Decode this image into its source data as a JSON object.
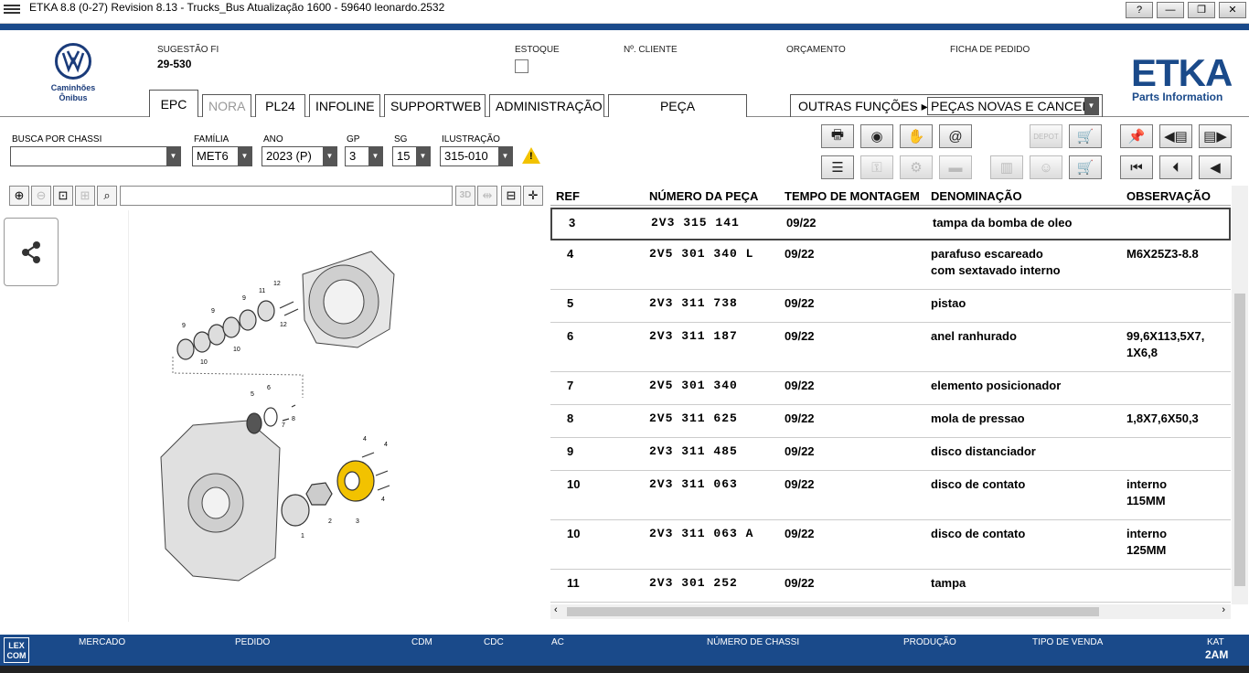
{
  "window": {
    "title": "ETKA 8.8 (0-27) Revision 8.13 - Trucks_Bus Atualização 1600 - 59640 leonardo.2532",
    "buttons": [
      "?",
      "—",
      "❐",
      "✕"
    ]
  },
  "brand": {
    "vw_line1": "Caminhões",
    "vw_line2": "Ônibus",
    "etka": "ETKA",
    "etka_sub": "Parts Information"
  },
  "header": {
    "sugestao_label": "SUGESTÃO FI",
    "sugestao_value": "29-530",
    "estoque_label": "ESTOQUE",
    "cliente_label": "Nº. CLIENTE",
    "orcamento_label": "ORÇAMENTO",
    "ficha_label": "FICHA DE PEDIDO"
  },
  "tabs": [
    {
      "label": "EPC"
    },
    {
      "label": "NORA"
    },
    {
      "label": "PL24"
    },
    {
      "label": "INFOLINE"
    },
    {
      "label": "SUPPORTWEB"
    },
    {
      "label": "ADMINISTRAÇÃO"
    },
    {
      "label": "PEÇA NORMALIZADA"
    }
  ],
  "outras": {
    "label": "OUTRAS FUNÇÕES",
    "value": "PEÇAS NOVAS E CANCEL."
  },
  "filters": {
    "chassi_label": "BUSCA POR CHASSI",
    "chassi_value": "",
    "familia_label": "FAMÍLIA",
    "familia_value": "MET6",
    "ano_label": "ANO",
    "ano_value": "2023 (P)",
    "gp_label": "GP",
    "gp_value": "3",
    "sg_label": "SG",
    "sg_value": "15",
    "ilustracao_label": "ILUSTRAÇÃO",
    "ilustracao_value": "315-010"
  },
  "toolbar": {
    "depot_label": "DEPOT"
  },
  "zoom": {
    "three_d": "3D"
  },
  "table": {
    "headers": {
      "ref": "REF",
      "numero": "NÚMERO DA PEÇA",
      "tempo": "TEMPO DE MONTAGEM",
      "denominacao": "DENOMINAÇÃO",
      "observacao": "OBSERVAÇÃO"
    },
    "rows": [
      {
        "ref": "3",
        "numero": "2V3 315 141",
        "tempo": "09/22",
        "den1": "tampa da bomba de oleo",
        "den2": "",
        "obs1": "",
        "obs2": ""
      },
      {
        "ref": "4",
        "numero": "2V5 301 340 L",
        "tempo": "09/22",
        "den1": "parafuso escareado",
        "den2": "com sextavado interno",
        "obs1": "M6X25Z3-8.8",
        "obs2": ""
      },
      {
        "ref": "5",
        "numero": "2V3 311 738",
        "tempo": "09/22",
        "den1": "pistao",
        "den2": "",
        "obs1": "",
        "obs2": ""
      },
      {
        "ref": "6",
        "numero": "2V3 311 187",
        "tempo": "09/22",
        "den1": "anel ranhurado",
        "den2": "",
        "obs1": "99,6X113,5X7,",
        "obs2": "1X6,8"
      },
      {
        "ref": "7",
        "numero": "2V5 301 340",
        "tempo": "09/22",
        "den1": "elemento posicionador",
        "den2": "",
        "obs1": "",
        "obs2": ""
      },
      {
        "ref": "8",
        "numero": "2V5 311 625",
        "tempo": "09/22",
        "den1": "mola de pressao",
        "den2": "",
        "obs1": "1,8X7,6X50,3",
        "obs2": ""
      },
      {
        "ref": "9",
        "numero": "2V3 311 485",
        "tempo": "09/22",
        "den1": "disco distanciador",
        "den2": "",
        "obs1": "",
        "obs2": ""
      },
      {
        "ref": "10",
        "numero": "2V3 311 063",
        "tempo": "09/22",
        "den1": "disco de contato",
        "den2": "",
        "obs1": "interno",
        "obs2": "115MM"
      },
      {
        "ref": "10",
        "numero": "2V3 311 063 A",
        "tempo": "09/22",
        "den1": "disco de contato",
        "den2": "",
        "obs1": "interno",
        "obs2": "125MM"
      },
      {
        "ref": "11",
        "numero": "2V3 301 252",
        "tempo": "09/22",
        "den1": "tampa",
        "den2": "",
        "obs1": "",
        "obs2": ""
      }
    ]
  },
  "drawing_labels": [
    "12",
    "11",
    "12",
    "9",
    "9",
    "10",
    "10",
    "9",
    "5",
    "6",
    "7",
    "8",
    "4",
    "4",
    "4",
    "1",
    "2",
    "3"
  ],
  "status": {
    "lexcom_line1": "LEX",
    "lexcom_line2": "COM",
    "mercado": "MERCADO",
    "pedido": "PEDIDO",
    "cdm": "CDM",
    "cdc": "CDC",
    "ac": "AC",
    "chassi": "NÚMERO DE CHASSI",
    "producao": "PRODUÇÃO",
    "tipo_venda": "TIPO DE VENDA",
    "kat_label": "KAT",
    "kat_value": "2AM"
  },
  "icons": {
    "share": "share-icon",
    "warning": "warning-icon",
    "accent": "#1a4a8a",
    "highlight_part": "#f2c200"
  }
}
